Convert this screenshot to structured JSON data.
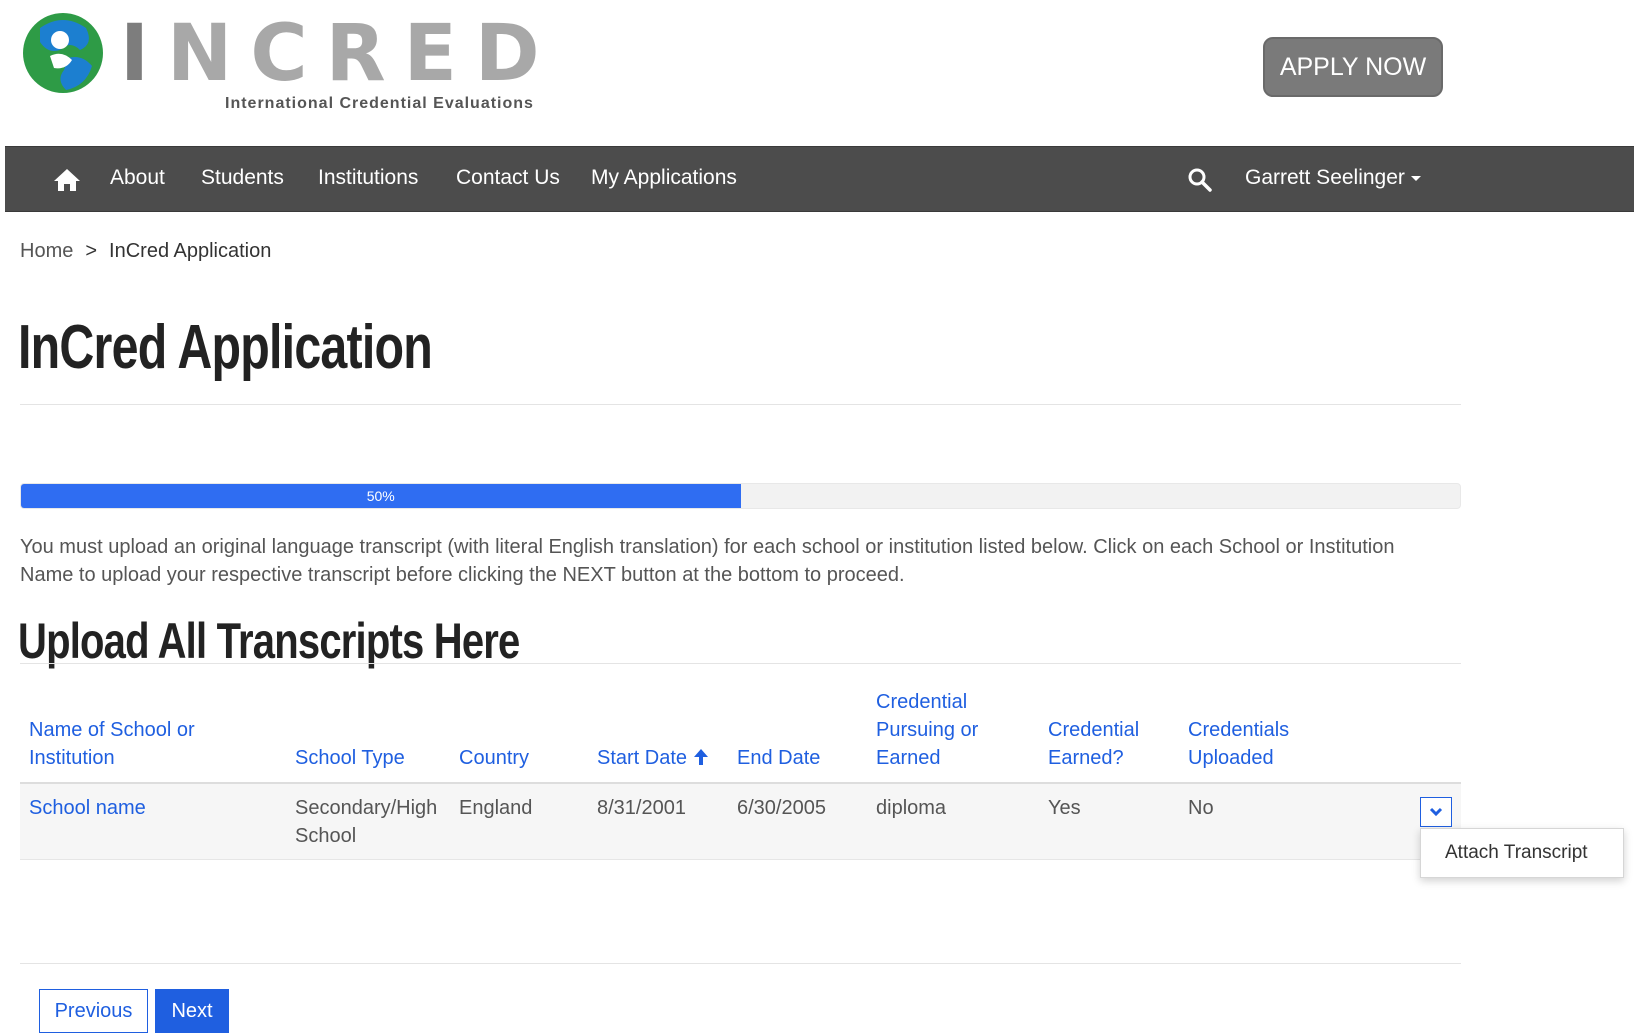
{
  "brand": {
    "wordmark_letters": [
      "I",
      "N",
      "C",
      "R",
      "E",
      "D"
    ],
    "tagline": "International Credential Evaluations",
    "colors": {
      "green": "#2e9b46",
      "blue": "#1c7fd0",
      "gray": "#a8a8a8"
    }
  },
  "header": {
    "apply_label": "APPLY NOW"
  },
  "nav": {
    "home_icon": "home-icon",
    "items": [
      {
        "label": "About"
      },
      {
        "label": "Students"
      },
      {
        "label": "Institutions"
      },
      {
        "label": "Contact Us"
      },
      {
        "label": "My Applications"
      }
    ],
    "search_icon": "search-icon",
    "user_name": "Garrett Seelinger"
  },
  "breadcrumb": {
    "home": "Home",
    "separator": ">",
    "current": "InCred Application"
  },
  "page": {
    "title": "InCred Application",
    "progress": {
      "value": 0.5,
      "label": "50%"
    },
    "instructions": "You must upload an original language transcript (with literal English translation) for each school or institution listed below. Click on each School or Institution Name to upload your respective transcript before clicking the NEXT button at the bottom to proceed.",
    "section_title": "Upload All Transcripts Here"
  },
  "table": {
    "columns": [
      {
        "lines": [
          "Name of School or",
          "Institution"
        ]
      },
      {
        "lines": [
          "School Type"
        ]
      },
      {
        "lines": [
          "Country"
        ]
      },
      {
        "lines": [
          "Start Date"
        ],
        "sort": "ascending"
      },
      {
        "lines": [
          "End Date"
        ]
      },
      {
        "lines": [
          "Credential",
          "Pursuing or",
          "Earned"
        ]
      },
      {
        "lines": [
          "Credential",
          "Earned?"
        ]
      },
      {
        "lines": [
          "Credentials",
          "Uploaded"
        ]
      }
    ],
    "rows": [
      {
        "school_name": "School name",
        "school_type": [
          "Secondary/High",
          "School"
        ],
        "country": "England",
        "start_date": "8/31/2001",
        "end_date": "6/30/2005",
        "credential": "diploma",
        "credential_earned": "Yes",
        "credentials_uploaded": "No"
      }
    ],
    "row_action_menu": {
      "item": "Attach Transcript"
    }
  },
  "footer_buttons": {
    "previous": "Previous",
    "next": "Next"
  },
  "accent_color": "#1f5fe0"
}
